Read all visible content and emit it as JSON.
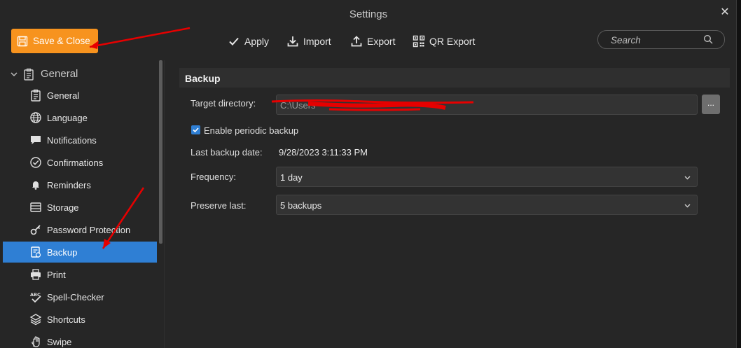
{
  "window": {
    "title": "Settings"
  },
  "toolbar": {
    "save_close": "Save & Close",
    "apply": "Apply",
    "import": "Import",
    "export": "Export",
    "qr_export": "QR Export",
    "search_placeholder": "Search"
  },
  "sidebar": {
    "group": "General",
    "items": [
      {
        "label": "General",
        "icon": "clipboard-icon"
      },
      {
        "label": "Language",
        "icon": "globe-icon"
      },
      {
        "label": "Notifications",
        "icon": "chat-bubble-icon"
      },
      {
        "label": "Confirmations",
        "icon": "check-circle-icon"
      },
      {
        "label": "Reminders",
        "icon": "bell-icon"
      },
      {
        "label": "Storage",
        "icon": "storage-icon"
      },
      {
        "label": "Password Protection",
        "icon": "key-icon"
      },
      {
        "label": "Backup",
        "icon": "backup-icon",
        "selected": true
      },
      {
        "label": "Print",
        "icon": "printer-icon"
      },
      {
        "label": "Spell-Checker",
        "icon": "spellcheck-icon"
      },
      {
        "label": "Shortcuts",
        "icon": "layers-icon"
      },
      {
        "label": "Swipe",
        "icon": "hand-icon"
      }
    ]
  },
  "backup": {
    "section_title": "Backup",
    "target_label": "Target directory:",
    "target_value": "C:\\Users",
    "browse_label": "...",
    "enable_label": "Enable periodic backup",
    "enable_checked": true,
    "last_date_label": "Last backup date:",
    "last_date_value": "9/28/2023 3:11:33 PM",
    "frequency_label": "Frequency:",
    "frequency_value": "1 day",
    "preserve_label": "Preserve last:",
    "preserve_value": "5 backups"
  },
  "colors": {
    "accent_orange": "#f7931e",
    "selection_blue": "#2f7fd4",
    "annotation_red": "#e60000"
  }
}
